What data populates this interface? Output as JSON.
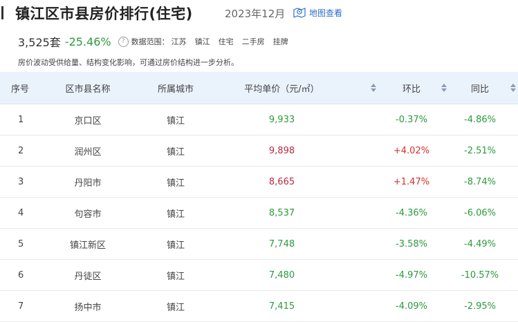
{
  "header": {
    "title": "镇江区市县房价排行(住宅)",
    "date": "2023年12月",
    "map_link": "地图查看"
  },
  "summary": {
    "count": "3,525套",
    "change": "-25.46%",
    "help_icon": "?",
    "range_label": "数据范围：",
    "range_items": [
      "江苏",
      "镇江",
      "住宅",
      "二手房",
      "挂牌"
    ]
  },
  "note": "房价波动受供给量、结构变化影响，可通过房价结构进一步分析。",
  "table": {
    "columns": [
      "序号",
      "区市县名称",
      "所属城市",
      "平均单价（元/㎡）",
      "环比",
      "同比"
    ],
    "rows": [
      {
        "no": "1",
        "name": "京口区",
        "city": "镇江",
        "price": "9,933",
        "mom": "-0.37%",
        "yoy": "-4.86%"
      },
      {
        "no": "2",
        "name": "润州区",
        "city": "镇江",
        "price": "9,898",
        "mom": "+4.02%",
        "yoy": "-2.51%"
      },
      {
        "no": "3",
        "name": "丹阳市",
        "city": "镇江",
        "price": "8,665",
        "mom": "+1.47%",
        "yoy": "-8.74%"
      },
      {
        "no": "4",
        "name": "句容市",
        "city": "镇江",
        "price": "8,537",
        "mom": "-4.36%",
        "yoy": "-6.06%"
      },
      {
        "no": "5",
        "name": "镇江新区",
        "city": "镇江",
        "price": "7,748",
        "mom": "-3.58%",
        "yoy": "-4.49%"
      },
      {
        "no": "6",
        "name": "丹徒区",
        "city": "镇江",
        "price": "7,480",
        "mom": "-4.97%",
        "yoy": "-10.57%"
      },
      {
        "no": "7",
        "name": "扬中市",
        "city": "镇江",
        "price": "7,415",
        "mom": "-4.09%",
        "yoy": "-2.95%"
      }
    ]
  },
  "colors": {
    "accent_blue": "#2f6fc6",
    "rise_red": "#d6302f",
    "fall_green": "#2b9a3b",
    "header_bg": "#eaf2fc"
  }
}
